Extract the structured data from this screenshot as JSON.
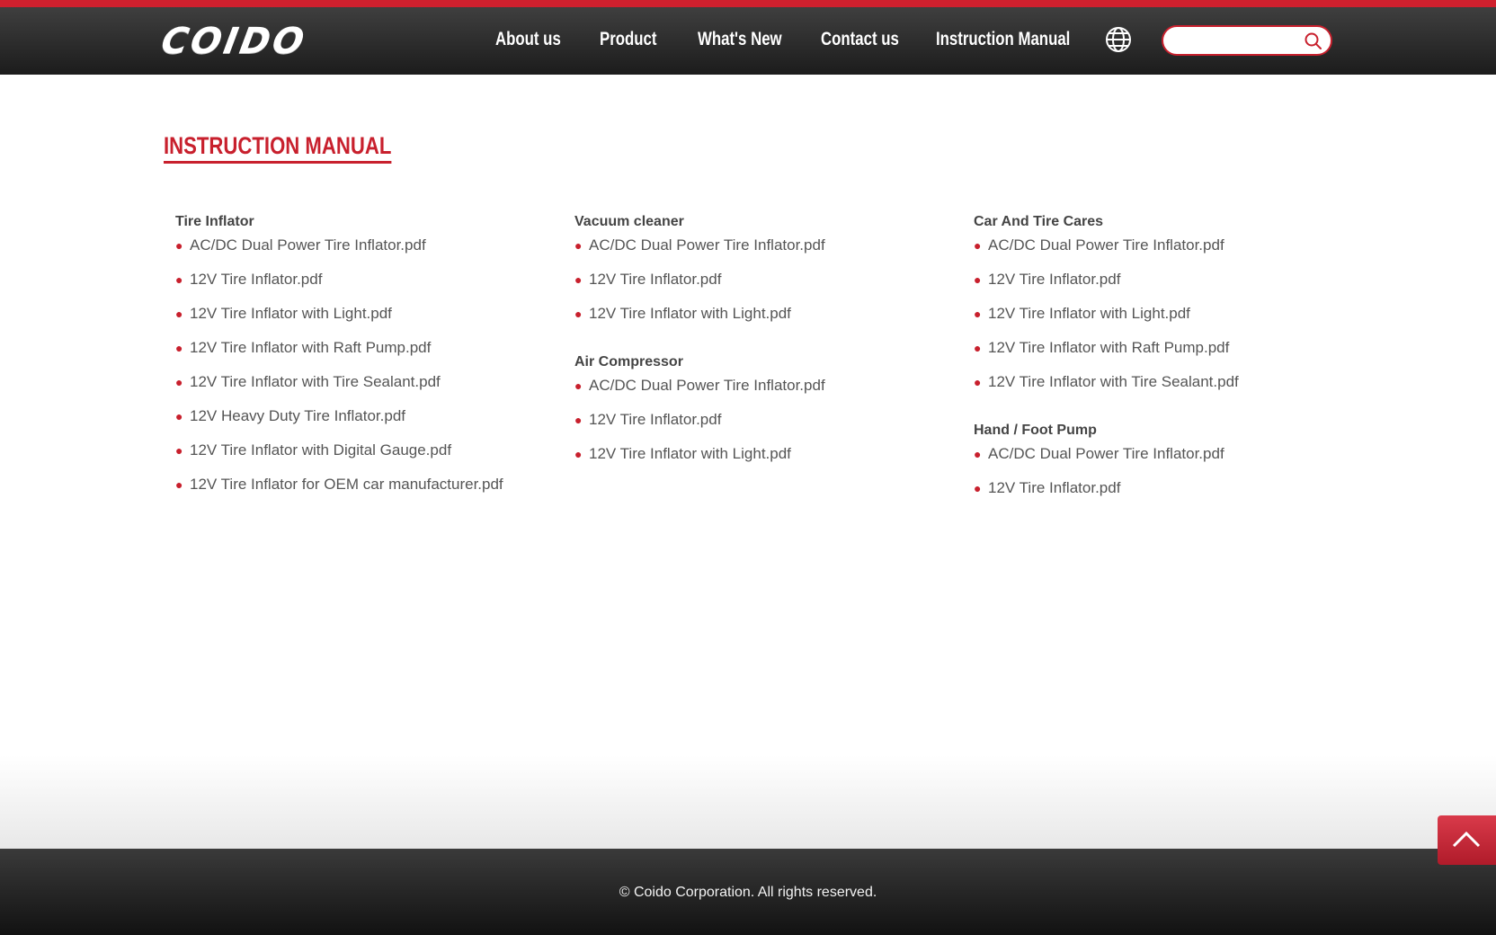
{
  "header": {
    "logo_text": "COIDO",
    "nav": [
      "About us",
      "Product",
      "What's New",
      "Contact us",
      "Instruction Manual"
    ],
    "search_placeholder": "",
    "accent_color": "#d0202e"
  },
  "page": {
    "title": "INSTRUCTION MANUAL"
  },
  "columns": [
    {
      "groups": [
        {
          "title": "Tire Inflator",
          "items": [
            "AC/DC Dual Power Tire Inflator.pdf",
            "12V Tire Inflator.pdf",
            "12V Tire Inflator with Light.pdf",
            "12V Tire Inflator with Raft Pump.pdf",
            "12V Tire Inflator with Tire Sealant.pdf",
            "12V Heavy Duty Tire Inflator.pdf",
            "12V Tire Inflator with Digital Gauge.pdf",
            "12V Tire Inflator for OEM car manufacturer.pdf"
          ]
        }
      ]
    },
    {
      "groups": [
        {
          "title": "Vacuum cleaner",
          "items": [
            "AC/DC Dual Power Tire Inflator.pdf",
            "12V Tire Inflator.pdf",
            "12V Tire Inflator with Light.pdf"
          ]
        },
        {
          "title": "Air Compressor",
          "items": [
            "AC/DC Dual Power Tire Inflator.pdf",
            "12V Tire Inflator.pdf",
            "12V Tire Inflator with Light.pdf"
          ]
        }
      ]
    },
    {
      "groups": [
        {
          "title": "Car And Tire Cares",
          "items": [
            "AC/DC Dual Power Tire Inflator.pdf",
            "12V Tire Inflator.pdf",
            "12V Tire Inflator with Light.pdf",
            "12V Tire Inflator with Raft Pump.pdf",
            "12V Tire Inflator with Tire Sealant.pdf"
          ]
        },
        {
          "title": "Hand / Foot Pump",
          "items": [
            "AC/DC Dual Power Tire Inflator.pdf",
            "12V Tire Inflator.pdf"
          ]
        }
      ]
    }
  ],
  "footer": {
    "copyright": "© Coido Corporation. All rights reserved."
  },
  "icons": {
    "globe": "globe-icon",
    "search": "search-icon",
    "back_to_top": "chevron-up-icon",
    "bullet": "•"
  }
}
